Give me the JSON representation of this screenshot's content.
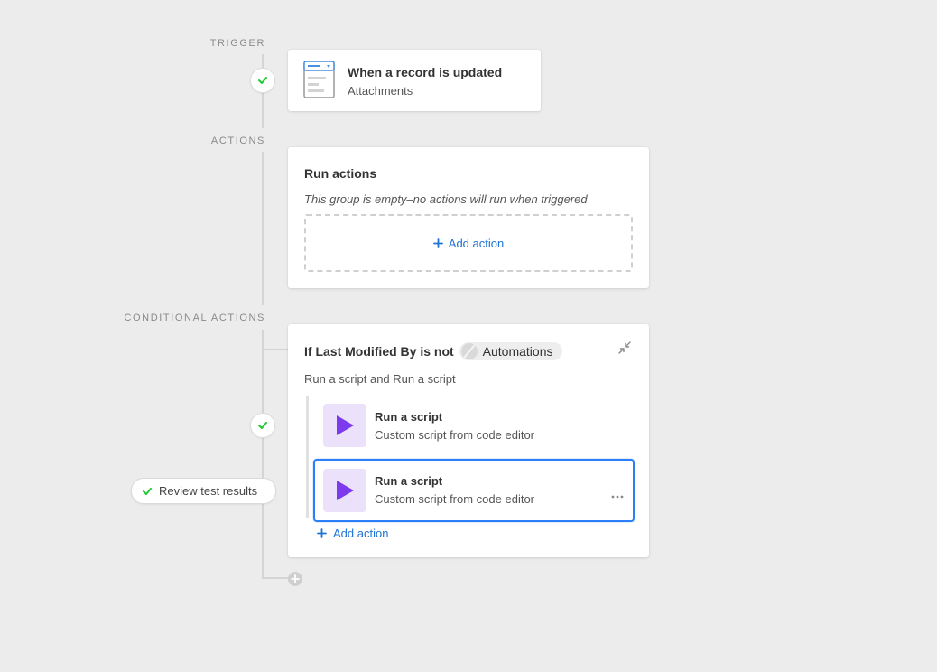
{
  "sections": {
    "trigger_label": "TRIGGER",
    "actions_label": "ACTIONS",
    "conditional_label": "CONDITIONAL ACTIONS"
  },
  "trigger": {
    "title": "When a record is updated",
    "subtitle": "Attachments",
    "status": "success"
  },
  "run_actions": {
    "title": "Run actions",
    "empty_note": "This group is empty–no actions will run when triggered",
    "add_action_label": "Add action"
  },
  "conditional": {
    "condition_prefix": "If Last Modified By is not",
    "condition_value": "Automations",
    "summary": "Run a script and Run a script",
    "actions": [
      {
        "title": "Run a script",
        "subtitle": "Custom script from code editor"
      },
      {
        "title": "Run a script",
        "subtitle": "Custom script from code editor"
      }
    ],
    "add_action_label": "Add action",
    "review_button": "Review test results"
  },
  "colors": {
    "accent_blue": "#1e73d6",
    "selected_border": "#2d7ff9",
    "success_green": "#20c933",
    "script_purple": "#7c39ed",
    "script_tile_bg": "#ece1fb"
  }
}
